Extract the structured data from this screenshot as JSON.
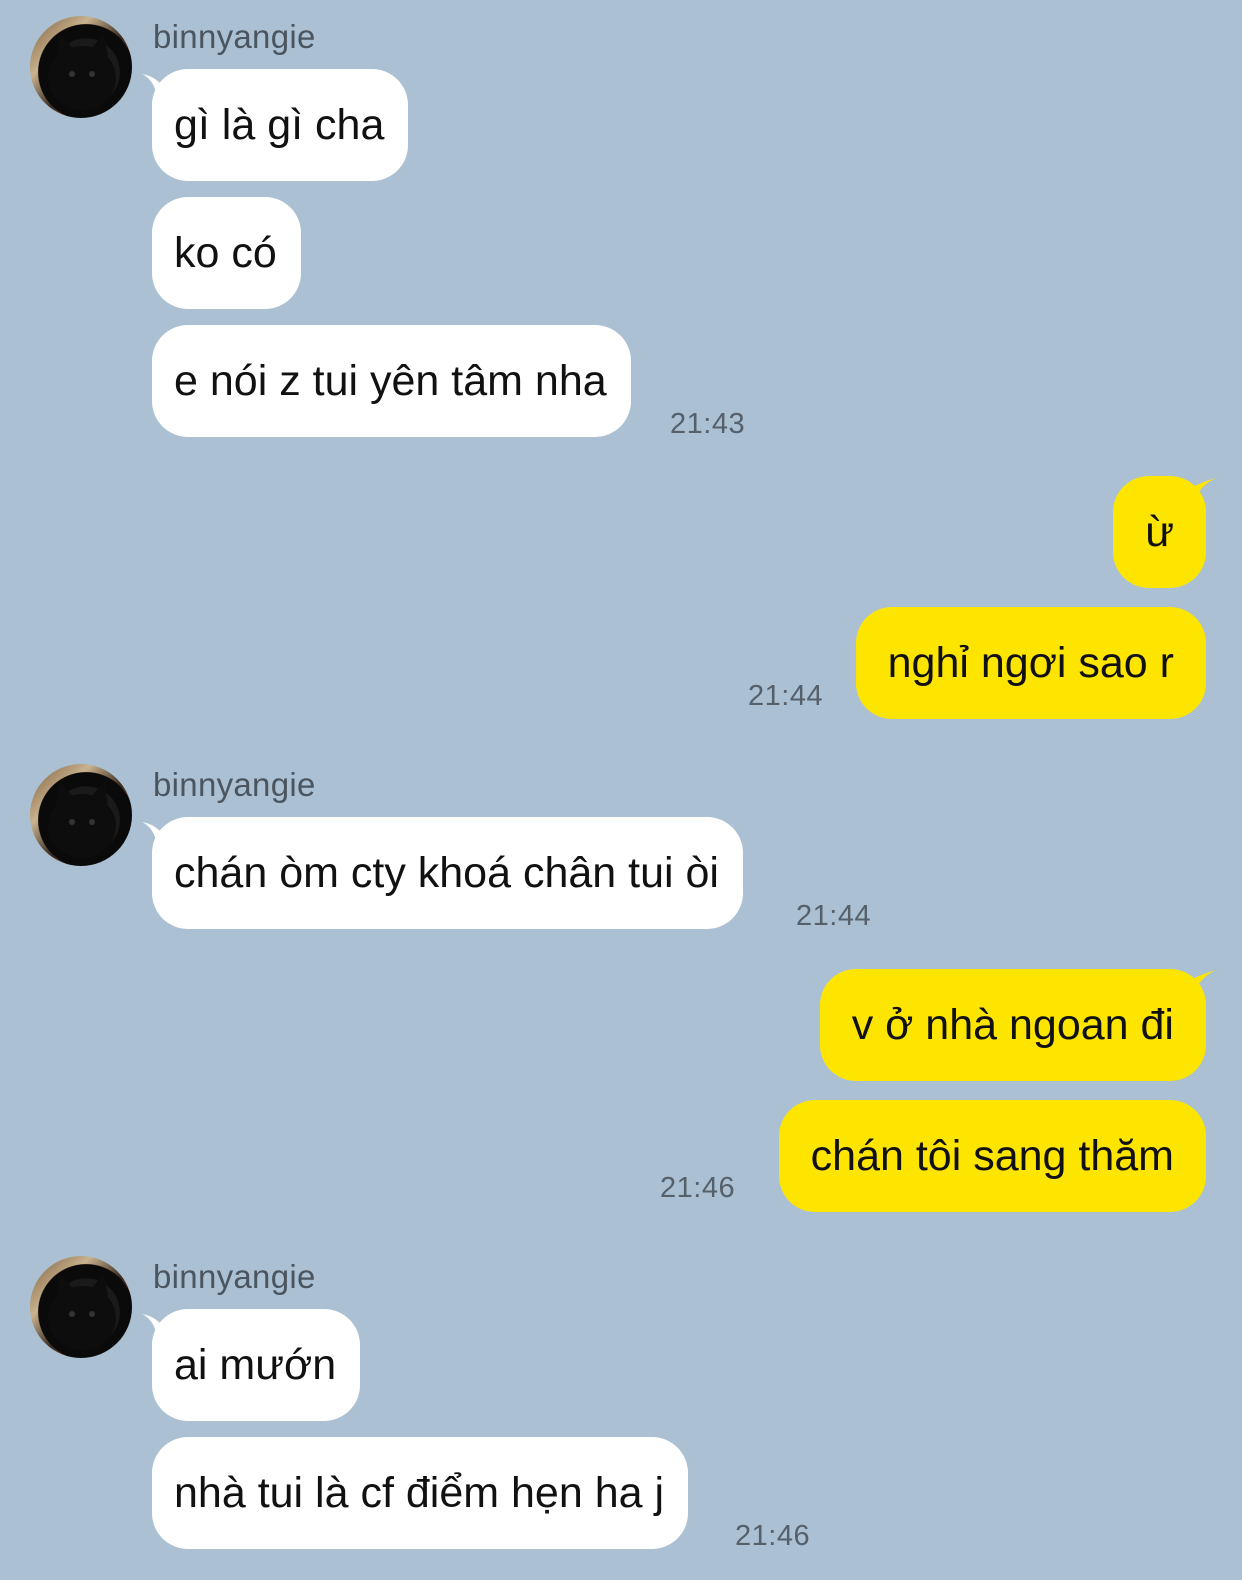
{
  "chat": {
    "sender_name": "binnyangie",
    "groups": [
      {
        "sender": "binnyangie",
        "messages": [
          "gì là gì cha",
          "ko có",
          "e nói z tui yên tâm nha"
        ],
        "time": "21:43"
      },
      {
        "sender": "me",
        "messages": [
          "ừ",
          "nghỉ ngơi sao r"
        ],
        "time": "21:44"
      },
      {
        "sender": "binnyangie",
        "messages": [
          "chán òm cty khoá chân tui òi"
        ],
        "time": "21:44"
      },
      {
        "sender": "me",
        "messages": [
          "v ở nhà ngoan đi",
          "chán tôi sang thăm"
        ],
        "time": "21:46"
      },
      {
        "sender": "binnyangie",
        "messages": [
          "ai mướn",
          "nhà tui là cf điểm hẹn ha j"
        ],
        "time": "21:46"
      }
    ]
  },
  "colors": {
    "background": "#abc1d3",
    "incoming_bubble": "#ffffff",
    "outgoing_bubble": "#fee500",
    "timestamp": "#55606b"
  },
  "icons": {
    "avatar": "black-cat-avatar"
  }
}
